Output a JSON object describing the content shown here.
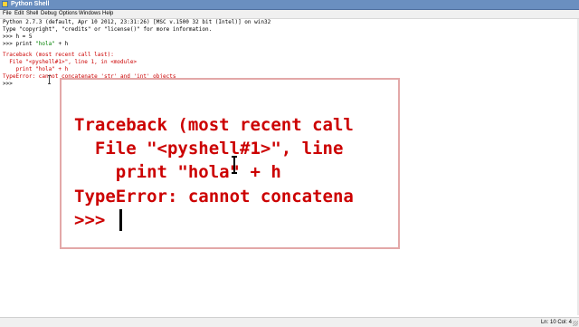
{
  "window": {
    "title": "Python Shell"
  },
  "menu": {
    "items": [
      "File",
      "Edit",
      "Shell",
      "Debug",
      "Options",
      "Windows",
      "Help"
    ]
  },
  "shell": {
    "banner_1": "Python 2.7.3 (default, Apr 10 2012, 23:31:26) [MSC v.1500 32 bit (Intel)] on win32",
    "banner_2": "Type \"copyright\", \"credits\" or \"license()\" for more information.",
    "prompt": ">>> ",
    "cmd_1": "h = 5",
    "cmd_2_code": "print ",
    "cmd_2_string": "\"hola\"",
    "cmd_2_rest": " + h",
    "tb_1": "Traceback (most recent call last):",
    "tb_2": "  File \"<pyshell#1>\", line 1, in <module>",
    "tb_3": "    print \"hola\" + h",
    "tb_4": "TypeError: cannot concatenate 'str' and 'int' objects",
    "final_prompt": ">>> "
  },
  "zoom": {
    "line_1": "Traceback (most recent call",
    "line_2": "  File \"<pyshell#1>\", line",
    "line_3": "    print \"hola\" + h",
    "line_4": "TypeError: cannot concatena",
    "prompt": ">>> "
  },
  "status": {
    "position": "Ln: 10 Col: 4"
  },
  "colors": {
    "error_red": "#cc0000",
    "string_green": "#008000",
    "titlebar_blue": "#6a8fc0"
  }
}
